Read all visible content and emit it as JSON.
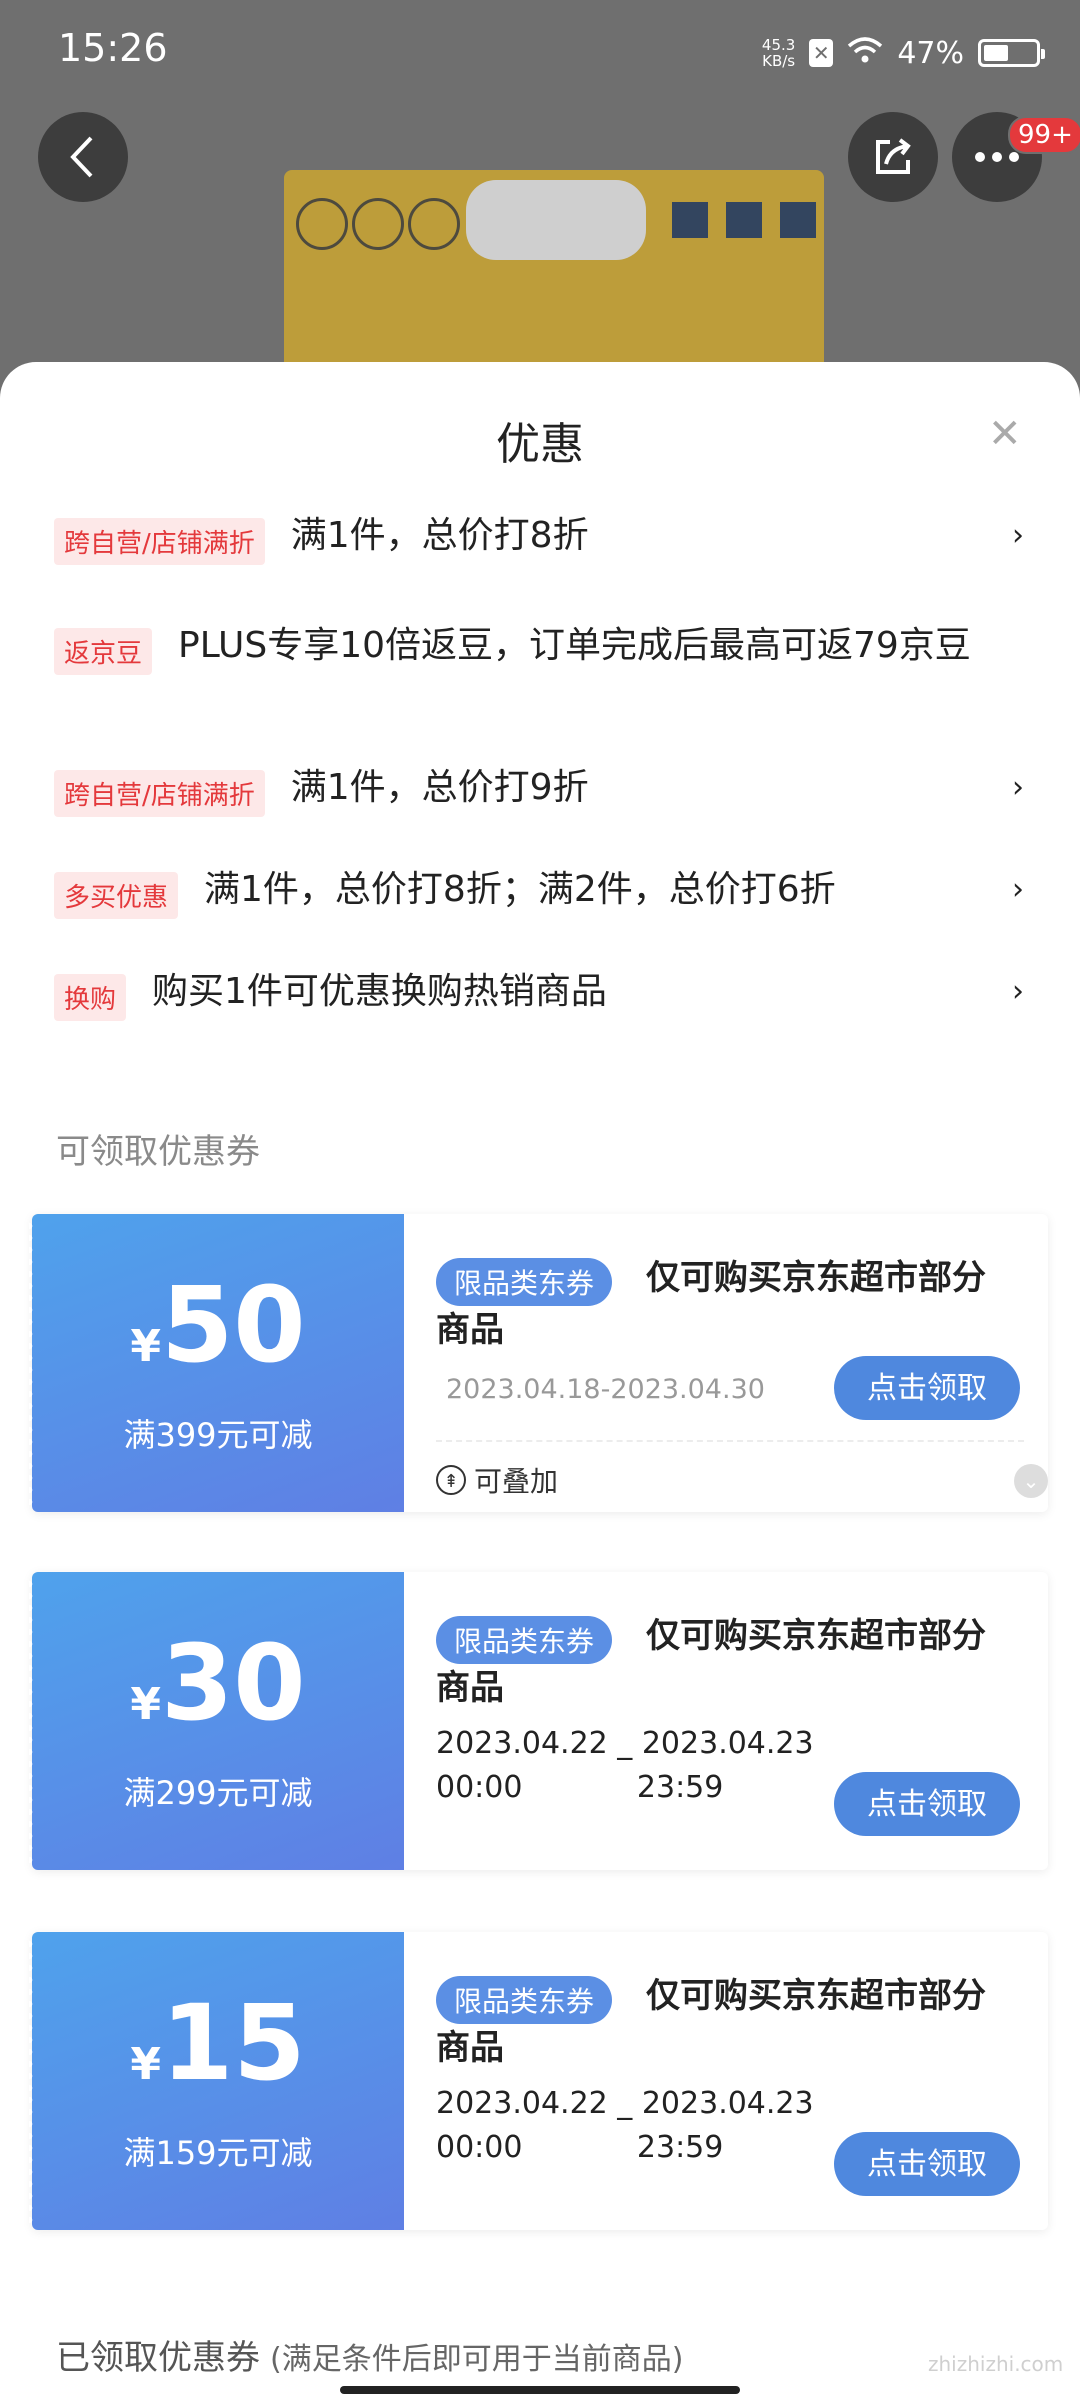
{
  "status_bar": {
    "time": "15:26",
    "net_speed_value": "45.3",
    "net_speed_unit": "KB/s",
    "battery_percent": "47%",
    "battery_level": 0.47
  },
  "header": {
    "more_badge": "99+"
  },
  "sheet": {
    "title": "优惠"
  },
  "promotions": [
    {
      "tag": "跨自营/店铺满折",
      "text": "满1件，总价打8折",
      "has_arrow": true
    },
    {
      "tag": "返京豆",
      "text": "PLUS专享10倍返豆，订单完成后最高可返79京豆",
      "has_arrow": false
    },
    {
      "tag": "跨自营/店铺满折",
      "text": "满1件，总价打9折",
      "has_arrow": true
    },
    {
      "tag": "多买优惠",
      "text": "满1件，总价打8折；满2件，总价打6折",
      "has_arrow": true
    },
    {
      "tag": "换购",
      "text": "购买1件可优惠换购热销商品",
      "has_arrow": true
    }
  ],
  "arrow_glyph": "›",
  "available_section": {
    "label": "可领取优惠券"
  },
  "coupons": [
    {
      "currency": "¥",
      "amount": "50",
      "condition": "满399元可减",
      "tag": "限品类东券",
      "desc": "仅可购买京东超市部分商品",
      "date": "2023.04.18-2023.04.30",
      "button": "点击领取",
      "stack_label": "可叠加"
    },
    {
      "currency": "¥",
      "amount": "30",
      "condition": "满299元可减",
      "tag": "限品类东券",
      "desc": "仅可购买京东超市部分商品",
      "date_line1": "2023.04.22 _ 2023.04.23",
      "date_line2": "00:00            23:59",
      "button": "点击领取"
    },
    {
      "currency": "¥",
      "amount": "15",
      "condition": "满159元可减",
      "tag": "限品类东券",
      "desc": "仅可购买京东超市部分商品",
      "date_line1": "2023.04.22 _ 2023.04.23",
      "date_line2": "00:00            23:59",
      "button": "点击领取"
    }
  ],
  "claimed_section": {
    "label": "已领取优惠券",
    "sub": "(满足条件后即可用于当前商品)"
  },
  "watermark": "zhizhizhi.com"
}
